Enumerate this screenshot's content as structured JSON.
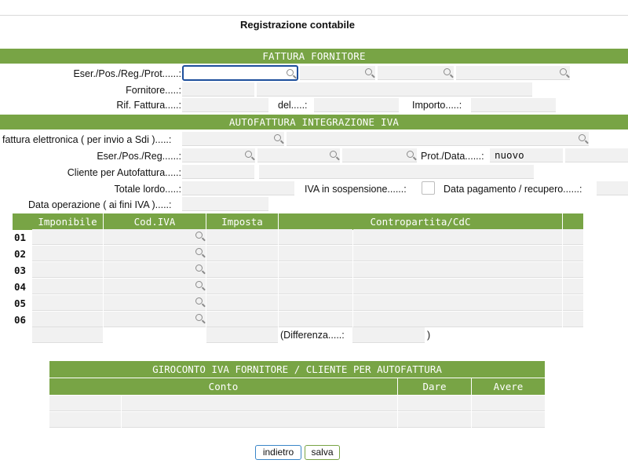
{
  "page": {
    "title": "Registrazione contabile"
  },
  "fattura_fornitore": {
    "header": "FATTURA FORNITORE",
    "eser_label": "Eser./Pos./Reg./Prot......:",
    "fornitore_label": "Fornitore.....:",
    "rif_label": "Rif. Fattura.....:",
    "del_label": "del.....:",
    "importo_label": "Importo.....:"
  },
  "autofattura": {
    "header": "AUTOFATTURA INTEGRAZIONE IVA",
    "fe_label": "fattura elettronica ( per invio a Sdi ).....:",
    "eser_label": "Eser./Pos./Reg......:",
    "prot_label": "Prot./Data......:",
    "prot_value": "nuovo",
    "cliente_label": "Cliente per Autofattura.....:",
    "totale_label": "Totale lordo.....:",
    "iva_sosp_label": "IVA in sospensione......:",
    "data_pag_label": "Data pagamento / recupero......:",
    "data_op_label": "Data operazione ( ai fini IVA ).....:"
  },
  "righe_iva": {
    "columns": [
      "Imponibile",
      "Cod.IVA",
      "Imposta",
      "Contropartita/CdC"
    ],
    "rows": [
      "01",
      "02",
      "03",
      "04",
      "05",
      "06"
    ],
    "differenza_label": "(Differenza.....:",
    "differenza_close": ")"
  },
  "giroconto": {
    "header": "GIROCONTO IVA FORNITORE / CLIENTE PER AUTOFATTURA",
    "columns": [
      "Conto",
      "Dare",
      "Avere"
    ]
  },
  "buttons": {
    "indietro": "indietro",
    "salva": "salva"
  },
  "colors": {
    "band_green": "#78a445",
    "focus_blue": "#1d4f9c",
    "field_gray": "#f1f1f1"
  }
}
